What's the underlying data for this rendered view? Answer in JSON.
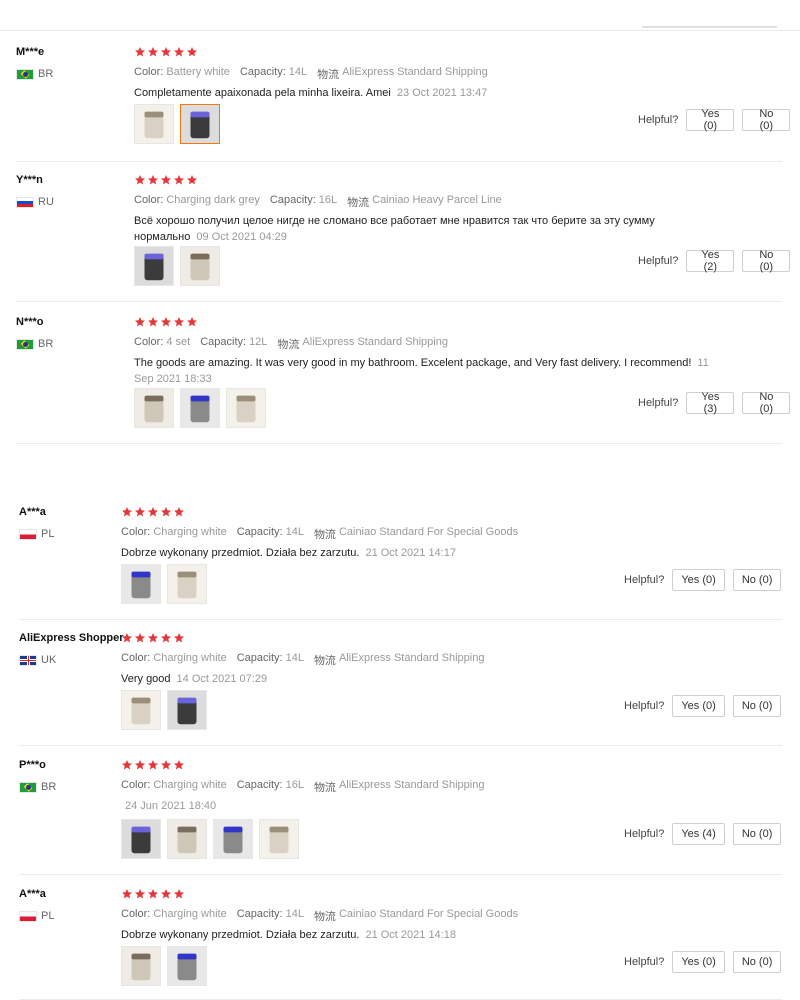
{
  "colors": {
    "star": "#e4393c",
    "selected_thumb": "#f07a10",
    "muted": "#999999"
  },
  "helpful_label": "Helpful?",
  "meta_labels": {
    "color": "Color:",
    "capacity": "Capacity:",
    "shipping": "物流"
  },
  "reviews": [
    {
      "user": "M***e",
      "country": "BR",
      "flag": "br",
      "stars": 5,
      "color": "Battery white",
      "capacity": "14L",
      "shipping": "AliExpress Standard Shipping",
      "text": "Completamente apaixonada pela minha lixeira. Amei",
      "date": "23 Oct 2021 13:47",
      "yes": "Yes (0)",
      "no": "No (0)",
      "thumbs": [
        "trash-bin-photo",
        "trash-bin-photo"
      ]
    },
    {
      "user": "Y***n",
      "country": "RU",
      "flag": "ru",
      "stars": 5,
      "color": "Charging dark grey",
      "capacity": "16L",
      "shipping": "Cainiao Heavy Parcel Line",
      "text": "Всё хорошо получил целое нигде не сломано все работает мне нравится так что берите за эту сумму нормально",
      "date": "09 Oct 2021 04:29",
      "yes": "Yes (2)",
      "no": "No (0)",
      "thumbs": [
        "trash-bin-photo",
        "trash-bin-photo"
      ]
    },
    {
      "user": "N***o",
      "country": "BR",
      "flag": "br",
      "stars": 5,
      "color": "4 set",
      "capacity": "12L",
      "shipping": "AliExpress Standard Shipping",
      "text": "The goods are amazing. It was very good in my bathroom. Excelent package, and Very fast delivery. I recommend!",
      "date": "11 Sep 2021 18:33",
      "yes": "Yes (3)",
      "no": "No (0)",
      "thumbs": [
        "trash-bin-photo",
        "trash-bin-photo",
        "trash-bin-photo"
      ]
    },
    {
      "user": "A***a",
      "country": "PL",
      "flag": "pl",
      "stars": 5,
      "color": "Charging white",
      "capacity": "14L",
      "shipping": "Cainiao Standard For Special Goods",
      "text": "Dobrze wykonany przedmiot. Działa bez zarzutu.",
      "date": "21 Oct 2021 14:17",
      "yes": "Yes (0)",
      "no": "No (0)",
      "thumbs": [
        "trash-bin-photo",
        "trash-bin-photo"
      ]
    },
    {
      "user": "AliExpress Shopper",
      "country": "UK",
      "flag": "uk",
      "stars": 5,
      "color": "Charging white",
      "capacity": "14L",
      "shipping": "AliExpress Standard Shipping",
      "text": "Very good",
      "date": "14 Oct 2021 07:29",
      "yes": "Yes (0)",
      "no": "No (0)",
      "thumbs": [
        "trash-bin-photo",
        "trash-bin-photo"
      ]
    },
    {
      "user": "P***o",
      "country": "BR",
      "flag": "br",
      "stars": 5,
      "color": "Charging white",
      "capacity": "16L",
      "shipping": "AliExpress Standard Shipping",
      "text": "",
      "date": "24 Jun 2021 18:40",
      "yes": "Yes (4)",
      "no": "No (0)",
      "thumbs": [
        "trash-bin-photo",
        "trash-bin-photo",
        "trash-bin-photo",
        "trash-bin-photo"
      ]
    },
    {
      "user": "A***a",
      "country": "PL",
      "flag": "pl",
      "stars": 5,
      "color": "Charging white",
      "capacity": "14L",
      "shipping": "Cainiao Standard For Special Goods",
      "text": "Dobrze wykonany przedmiot. Działa bez zarzutu.",
      "date": "21 Oct 2021 14:18",
      "yes": "Yes (0)",
      "no": "No (0)",
      "thumbs": [
        "trash-bin-photo",
        "trash-bin-photo"
      ]
    }
  ]
}
